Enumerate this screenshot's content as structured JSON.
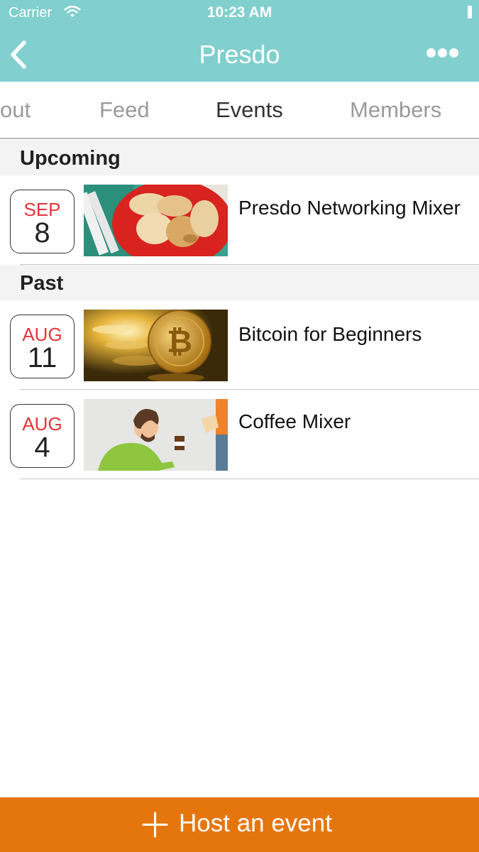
{
  "status_bar": {
    "carrier": "Carrier",
    "time": "10:23 AM",
    "wifi_icon": "wifi-icon",
    "battery_icon": "battery-icon"
  },
  "nav": {
    "title": "Presdo",
    "back_icon": "back-chevron-icon",
    "more_icon": "more-dots-icon",
    "bg_color": "#81cfcf"
  },
  "tabs": [
    {
      "label": "out",
      "active": false
    },
    {
      "label": "Feed",
      "active": false
    },
    {
      "label": "Events",
      "active": true
    },
    {
      "label": "Members",
      "active": false
    }
  ],
  "sections": {
    "upcoming": {
      "title": "Upcoming",
      "events": [
        {
          "month": "SEP",
          "day": "8",
          "title": "Presdo Networking Mixer",
          "image": "food-dumplings-image"
        }
      ]
    },
    "past": {
      "title": "Past",
      "events": [
        {
          "month": "AUG",
          "day": "11",
          "title": "Bitcoin for Beginners",
          "image": "bitcoin-coins-image"
        },
        {
          "month": "AUG",
          "day": "4",
          "title": "Coffee Mixer",
          "image": "coffee-illustration-image"
        }
      ]
    }
  },
  "footer": {
    "host_label": "Host an event",
    "plus_icon": "plus-icon",
    "bg_color": "#e5760e"
  },
  "colors": {
    "date_month": "#e5343a",
    "section_bg": "#f3f3f3"
  }
}
